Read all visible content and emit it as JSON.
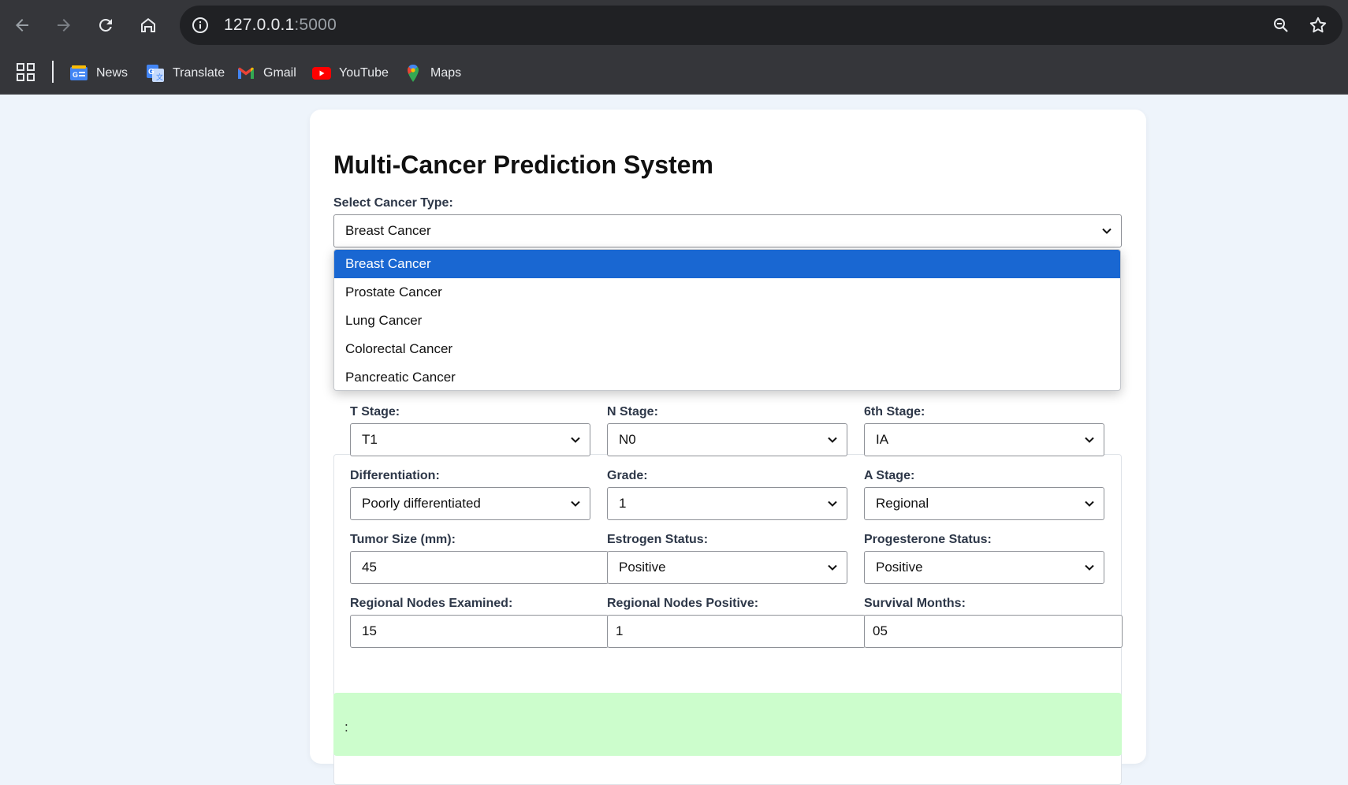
{
  "browser": {
    "url_host": "127.0.0.1",
    "url_port": ":5000",
    "bookmarks": [
      {
        "label": "News",
        "icon": "google-news-icon"
      },
      {
        "label": "Translate",
        "icon": "google-translate-icon"
      },
      {
        "label": "Gmail",
        "icon": "gmail-icon"
      },
      {
        "label": "YouTube",
        "icon": "youtube-icon"
      },
      {
        "label": "Maps",
        "icon": "maps-icon"
      }
    ]
  },
  "page": {
    "title": "Multi-Cancer Prediction System",
    "cancer_type_label": "Select Cancer Type:",
    "cancer_type_value": "Breast Cancer",
    "dropdown_options": [
      "Breast Cancer",
      "Prostate Cancer",
      "Lung Cancer",
      "Colorectal Cancer",
      "Pancreatic Cancer"
    ],
    "fields": {
      "t_stage": {
        "label": "T Stage:",
        "value": "T1"
      },
      "n_stage": {
        "label": "N Stage:",
        "value": "N0"
      },
      "sixth_stage": {
        "label": "6th Stage:",
        "value": "IA"
      },
      "differentiation": {
        "label": "Differentiation:",
        "value": "Poorly differentiated"
      },
      "grade": {
        "label": "Grade:",
        "value": "1"
      },
      "a_stage": {
        "label": "A Stage:",
        "value": "Regional"
      },
      "tumor_size": {
        "label": "Tumor Size (mm):",
        "value": "45"
      },
      "estrogen": {
        "label": "Estrogen Status:",
        "value": "Positive"
      },
      "progesterone": {
        "label": "Progesterone Status:",
        "value": "Positive"
      },
      "nodes_examined": {
        "label": "Regional Nodes Examined:",
        "value": "15"
      },
      "nodes_positive": {
        "label": "Regional Nodes Positive:",
        "value": "1"
      },
      "survival": {
        "label": "Survival Months:",
        "value": "05"
      }
    },
    "result_text": ":"
  },
  "colors": {
    "accent": "#1967d2",
    "result_bg": "#ccfdcc",
    "page_bg": "#eef4fb"
  }
}
